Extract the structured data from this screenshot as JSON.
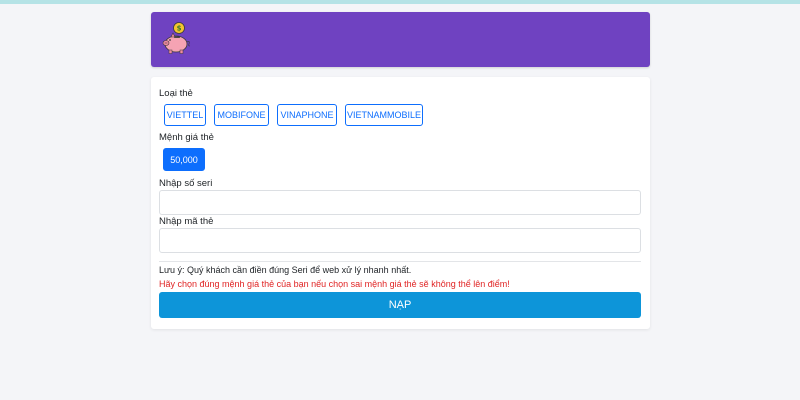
{
  "colors": {
    "header_bg": "#6f42c1",
    "primary": "#0d6efd",
    "submit_bg": "#0d95d9",
    "warning_text": "#e02424",
    "page_bg": "#f4f5f8"
  },
  "header": {
    "logo_icon": "piggy-bank-coin-icon"
  },
  "form": {
    "card_type_label": "Loại thẻ",
    "carriers": [
      "VIETTEL",
      "MOBIFONE",
      "VINAPHONE",
      "VIETNAMMOBILE"
    ],
    "amount_label": "Mệnh giá thẻ",
    "amounts": [
      "50,000"
    ],
    "selected_amount": "50,000",
    "serial": {
      "label": "Nhập số seri",
      "value": "",
      "placeholder": ""
    },
    "code": {
      "label": "Nhập mã thẻ",
      "value": "",
      "placeholder": ""
    },
    "note": "Lưu ý: Quý khách cần điền đúng Seri để web xử lý nhanh nhất.",
    "warning": "Hãy chọn đúng mệnh giá thẻ của bạn nếu chọn sai mệnh giá thẻ sẽ không thể lên điểm!",
    "submit_label": "NẠP"
  }
}
